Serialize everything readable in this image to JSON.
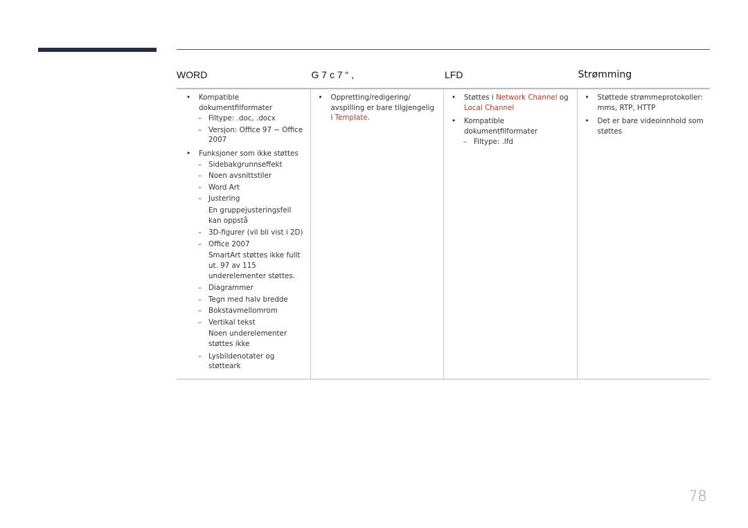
{
  "header": {
    "columns": [
      "WORD",
      "G 7 c 7 “ ,",
      "LFD",
      "Strømming"
    ]
  },
  "word": {
    "b1": "Kompatible dokumentfilformater",
    "b1_subs": [
      "Filtype: .doc, .docx",
      "Versjon: Office 97 ~ Office 2007"
    ],
    "b2": "Funksjoner som ikke støttes",
    "b2_subs": {
      "s1": "Sidebakgrunnseffekt",
      "s2": "Noen avsnittstiler",
      "s3": "Word Art",
      "s4": "Justering",
      "s4_note": "En gruppejusteringsfeil kan oppstå",
      "s5": "3D-figurer (vil bli vist i 2D)",
      "s6": "Office 2007",
      "s6_note": "SmartArt støttes ikke fullt ut. 97 av 115 underelementer støttes.",
      "s7": "Diagrammer",
      "s8": "Tegn med halv bredde",
      "s9": "Bokstavmellomrom",
      "s10": "Vertikal tekst",
      "s10_note": "Noen underelementer støttes ikke",
      "s11": "Lysbildenotater og støtteark"
    },
    "dash": "–"
  },
  "col2": {
    "b1_text": "Oppretting/redigering/ avspilling er bare tilgjengelig i ",
    "b1_link": "Template",
    "b1_end": "."
  },
  "lfd": {
    "b1_pre": "Støttes i ",
    "b1_link1": "Network Channel",
    "b1_mid": " og ",
    "b1_link2": "Local Channel",
    "b2": "Kompatible dokumentfilformater",
    "b2_sub": "Filtype: .lfd"
  },
  "stream": {
    "b1": "Støttede strømmeprotokoller: mms, RTP, HTTP",
    "b2": "Det er bare videoinnhold som støttes"
  },
  "colors": {
    "accent": "#c8361b",
    "bar": "#252c47"
  },
  "page_number": "78"
}
